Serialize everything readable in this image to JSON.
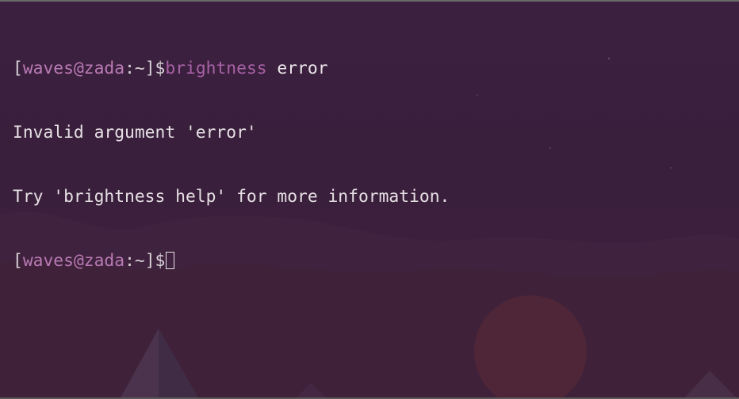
{
  "prompt": {
    "open_bracket": "[",
    "user": "waves",
    "at": "@",
    "host": "zada",
    "path": ":~",
    "close": "]$"
  },
  "command": {
    "name": "brightness",
    "arg": " error"
  },
  "output_lines": [
    "Invalid argument 'error'",
    "Try 'brightness help' for more information."
  ],
  "colors": {
    "background": "#3a1f3c",
    "text": "#e6e0e4",
    "prompt_accent": "#b97ab3",
    "command": "#a862a6"
  }
}
